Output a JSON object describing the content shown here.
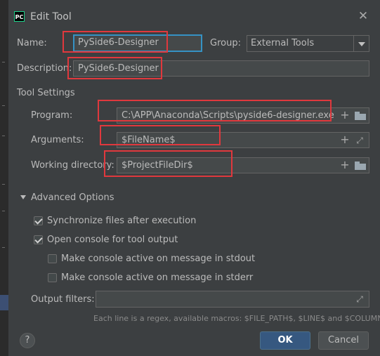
{
  "window": {
    "app_icon_text": "PC",
    "title": "Edit Tool",
    "close_glyph": "✕"
  },
  "form": {
    "name_label": "Name:",
    "name_value": "PySide6-Designer",
    "group_label": "Group:",
    "group_value": "External Tools",
    "description_label": "Description:",
    "description_value": "PySide6-Designer"
  },
  "tool_settings": {
    "section_title": "Tool Settings",
    "program_label": "Program:",
    "program_value": "C:\\APP\\Anaconda\\Scripts\\pyside6-designer.exe",
    "arguments_label": "Arguments:",
    "arguments_value": "$FileName$",
    "working_dir_label": "Working directory:",
    "working_dir_value": "$ProjectFileDir$"
  },
  "advanced": {
    "section_title": "Advanced Options",
    "options": [
      {
        "label": "Synchronize files after execution",
        "checked": true
      },
      {
        "label": "Open console for tool output",
        "checked": true
      },
      {
        "label": "Make console active on message in stdout",
        "checked": false
      },
      {
        "label": "Make console active on message in stderr",
        "checked": false
      }
    ],
    "output_filters_label": "Output filters:",
    "output_filters_value": "",
    "hint": "Each line is a regex, available macros: $FILE_PATH$, $LINE$ and $COLUMN$"
  },
  "footer": {
    "help_glyph": "?",
    "ok_label": "OK",
    "cancel_label": "Cancel"
  },
  "colors": {
    "background": "#3c3f41",
    "field": "#45494a",
    "focus_border": "#3592c4",
    "annotation_red": "#e0383d",
    "ok_button": "#365880"
  },
  "icons": [
    "app-icon",
    "close-icon",
    "dropdown-arrow-icon",
    "plus-icon",
    "folder-icon",
    "expand-icon",
    "collapse-triangle-icon",
    "checkbox-icon",
    "help-icon"
  ]
}
